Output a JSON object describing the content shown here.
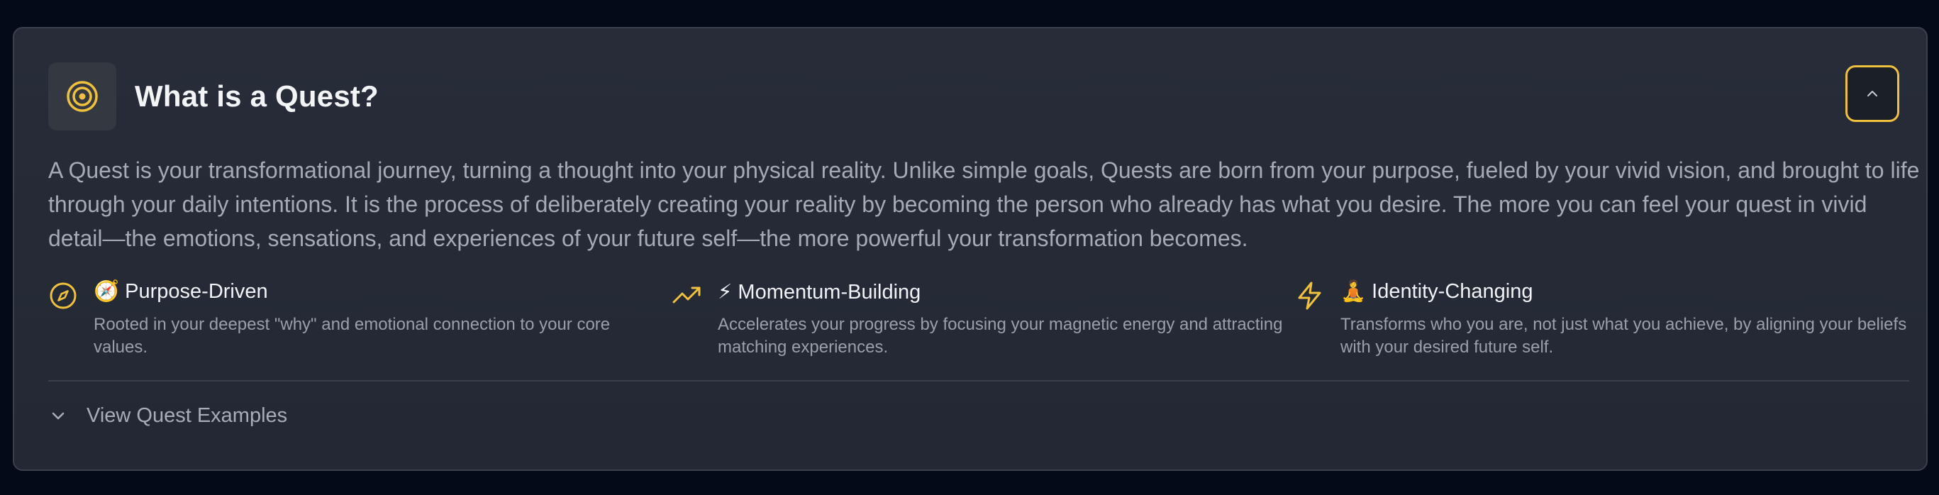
{
  "panel": {
    "title": "What is a Quest?",
    "header_icon": "target-icon",
    "collapse_icon": "chevron-up-icon",
    "description": "A Quest is your transformational journey, turning a thought into your physical reality. Unlike simple goals, Quests are born from your purpose, fueled by your vivid vision, and brought to life through your daily intentions. It is the process of deliberately creating your reality by becoming the person who already has what you desire. The more you can feel your quest in vivid detail—the emotions, sensations, and experiences of your future self—the more powerful your transformation becomes."
  },
  "features": [
    {
      "icon": "compass-icon",
      "title": "🧭 Purpose-Driven",
      "description": "Rooted in your deepest \"why\" and emotional connection to your core values."
    },
    {
      "icon": "trending-up-icon",
      "title": "⚡ Momentum-Building",
      "description": "Accelerates your progress by focusing your magnetic energy and attracting matching experiences."
    },
    {
      "icon": "lightning-icon",
      "title": "🧘 Identity-Changing",
      "description": "Transforms who you are, not just what you achieve, by aligning your beliefs with your desired future self."
    }
  ],
  "examples": {
    "label": "View Quest Examples",
    "icon": "chevron-down-icon"
  },
  "colors": {
    "accent": "#f0c23b",
    "card_background": "#262b37",
    "page_background": "#050a18",
    "title_text": "#f3f4f6",
    "body_text": "#a6aab4"
  }
}
